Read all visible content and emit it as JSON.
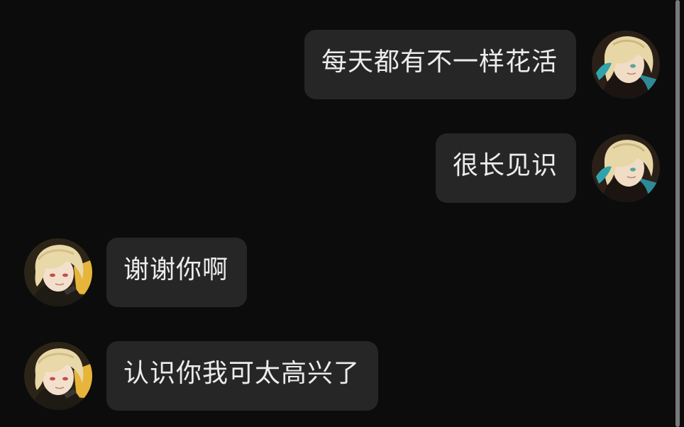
{
  "messages": [
    {
      "side": "right",
      "text": "每天都有不一样花活",
      "avatar": "user-avatar-icon"
    },
    {
      "side": "right",
      "text": "很长见识",
      "avatar": "user-avatar-icon"
    },
    {
      "side": "left",
      "text": "谢谢你啊",
      "avatar": "contact-avatar-icon"
    },
    {
      "side": "left",
      "text": "认识你我可太高兴了",
      "avatar": "contact-avatar-icon"
    }
  ],
  "colors": {
    "background": "#0c0c0c",
    "bubble": "#262626",
    "text": "#ececec"
  }
}
